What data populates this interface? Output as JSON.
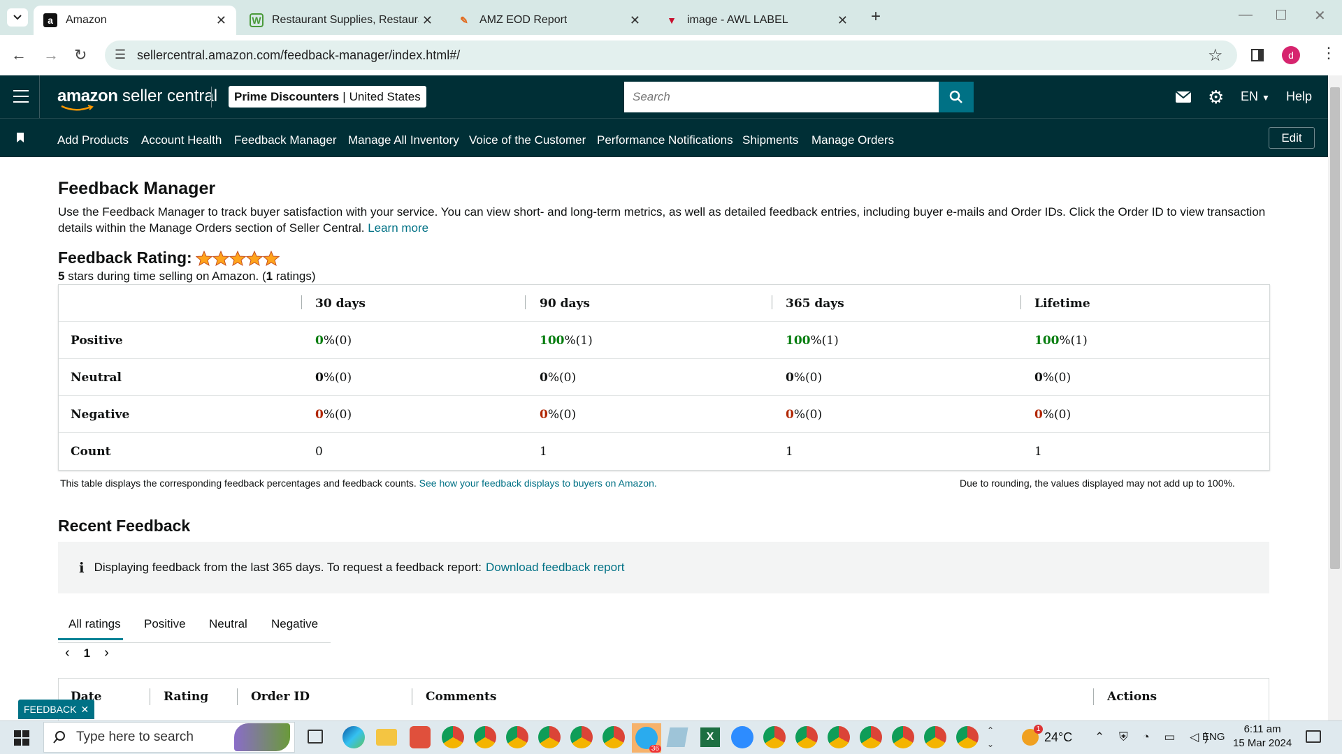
{
  "browser": {
    "tabs": [
      {
        "title": "Amazon",
        "favicon": "amazon-icon"
      },
      {
        "title": "Restaurant Supplies, Restaurant",
        "favicon": "webstaurant-icon"
      },
      {
        "title": "AMZ EOD Report",
        "favicon": "pen-icon"
      },
      {
        "title": "image - AWL LABEL",
        "favicon": "v-icon"
      }
    ],
    "url": "sellercentral.amazon.com/feedback-manager/index.html#/",
    "profile_initial": "d"
  },
  "header": {
    "logo_text_1": "amazon",
    "logo_text_2": "seller central",
    "store_name": "Prime Discounters",
    "marketplace": "United States",
    "search_placeholder": "Search",
    "language": "EN",
    "help": "Help"
  },
  "nav": {
    "items": [
      "Add Products",
      "Account Health",
      "Feedback Manager",
      "Manage All Inventory",
      "Voice of the Customer",
      "Performance Notifications",
      "Shipments",
      "Manage Orders"
    ],
    "edit": "Edit"
  },
  "main": {
    "title": "Feedback Manager",
    "description": "Use the Feedback Manager to track buyer satisfaction with your service. You can view short- and long-term metrics, as well as detailed feedback entries, including buyer e-mails and Order IDs. Click the Order ID to view transaction details within the Manage Orders section of Seller Central.",
    "learn_more": "Learn more",
    "rating_label": "Feedback Rating:",
    "stars": 5,
    "rating_summary_prefix": "5",
    "rating_summary_mid": " stars during time selling on Amazon. (",
    "rating_count": "1",
    "rating_summary_suffix": " ratings)",
    "table": {
      "columns": [
        "30 days",
        "90 days",
        "365 days",
        "Lifetime"
      ],
      "rows": [
        {
          "label": "Positive",
          "values": [
            [
              "0",
              " %(0)"
            ],
            [
              "100",
              " %(1)"
            ],
            [
              "100",
              " %(1)"
            ],
            [
              "100",
              " %(1)"
            ]
          ]
        },
        {
          "label": "Neutral",
          "values": [
            [
              "0",
              " %(0)"
            ],
            [
              "0",
              " %(0)"
            ],
            [
              "0",
              " %(0)"
            ],
            [
              "0",
              " %(0)"
            ]
          ]
        },
        {
          "label": "Negative",
          "values": [
            [
              "0",
              " %(0)"
            ],
            [
              "0",
              " %(0)"
            ],
            [
              "0",
              " %(0)"
            ],
            [
              "0",
              " %(0)"
            ]
          ]
        },
        {
          "label": "Count",
          "values": [
            [
              "0",
              ""
            ],
            [
              "1",
              ""
            ],
            [
              "1",
              ""
            ],
            [
              "1",
              ""
            ]
          ]
        }
      ]
    },
    "table_note": "This table displays the corresponding feedback percentages and feedback counts.",
    "table_note_link": "See how your feedback displays to buyers on Amazon.",
    "rounding_note": "Due to rounding, the values displayed may not add up to 100%.",
    "recent_title": "Recent Feedback",
    "info_text": "Displaying feedback from the last 365 days. To request a feedback report:",
    "info_link": "Download feedback report",
    "filter_tabs": [
      "All ratings",
      "Positive",
      "Neutral",
      "Negative"
    ],
    "page": "1",
    "recent_columns": [
      "Date",
      "Rating",
      "Order ID",
      "Comments",
      "Actions"
    ],
    "feedback_badge": "FEEDBACK"
  },
  "taskbar": {
    "search_placeholder": "Type here to search",
    "weather": "24°C",
    "language": "ENG",
    "time": "6:11 am",
    "date": "15 Mar 2024",
    "telegram_badge": "36",
    "weather_badge": "1"
  },
  "colors": {
    "header_bg": "#002f36",
    "link": "#007185",
    "positive": "#067d0f",
    "negative": "#b12704"
  }
}
